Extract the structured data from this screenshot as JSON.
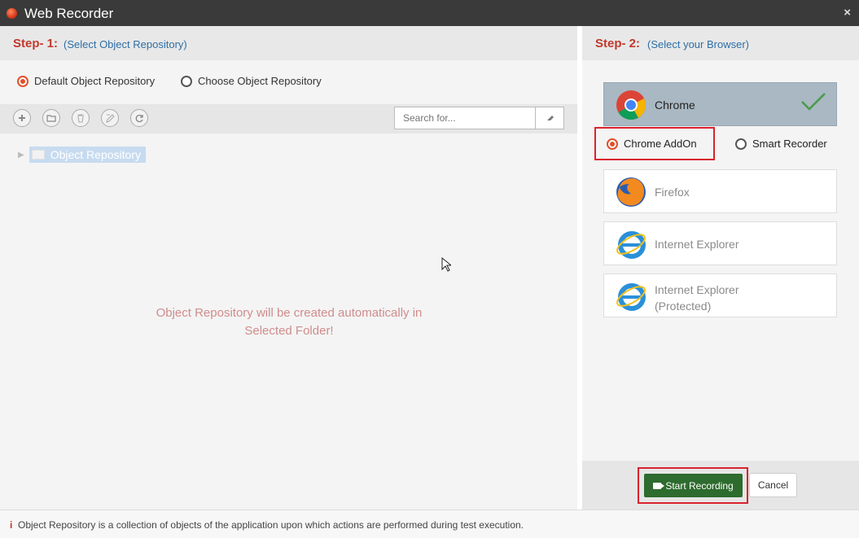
{
  "window": {
    "title": "Web Recorder",
    "close_glyph": "×"
  },
  "step1": {
    "label": "Step- 1:",
    "hint": "(Select Object Repository)",
    "options": [
      "Default Object Repository",
      "Choose Object Repository"
    ],
    "selected": "Default Object Repository"
  },
  "toolbar": {
    "icons": [
      "add-icon",
      "open-folder-icon",
      "delete-icon",
      "edit-icon",
      "refresh-icon"
    ],
    "search_placeholder": "Search for..."
  },
  "tree": {
    "root_label": "Object Repository"
  },
  "message": {
    "line1": "Object Repository will be created automatically in",
    "line2": "Selected Folder!"
  },
  "step2": {
    "label": "Step- 2:",
    "hint": "(Select your Browser)",
    "browsers": [
      {
        "name": "Chrome",
        "icon": "chrome-icon",
        "selected": true
      },
      {
        "name": "Firefox",
        "icon": "firefox-icon",
        "selected": false
      },
      {
        "name": "Internet Explorer",
        "icon": "ie-icon",
        "selected": false
      },
      {
        "name_line1": "Internet Explorer",
        "name_line2": "(Protected)",
        "icon": "ie-icon",
        "selected": false
      }
    ],
    "modes": [
      "Chrome AddOn",
      "Smart Recorder"
    ],
    "selected_mode": "Chrome AddOn"
  },
  "actions": {
    "start": "Start Recording",
    "cancel": "Cancel"
  },
  "status": {
    "icon": "info-icon",
    "text": "Object Repository is a collection of objects of the application upon which actions are performed during test execution."
  },
  "colors": {
    "accent": "#e0502b",
    "step": "#c0392b",
    "hint": "#2d6fa6",
    "start": "#2e6b2e",
    "highlight": "#d9232d"
  }
}
